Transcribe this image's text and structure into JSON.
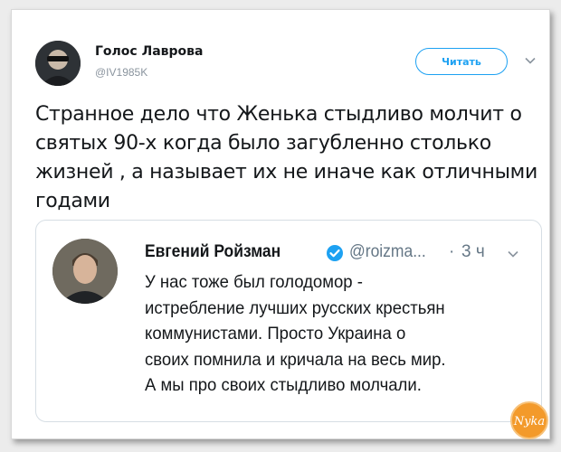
{
  "tweet": {
    "author_name": "Голос Лаврова",
    "author_handle": "@IV1985K",
    "follow_label": "Читать",
    "text": "Странное дело что Женька стыдливо молчит о святых 90-х когда было загубленно столько жизней , а называет их не иначе как отличными годами"
  },
  "quoted": {
    "author_name": "Евгений Ройзман",
    "handle": "@roizma...",
    "separator": "·",
    "time": "3 ч",
    "lines": [
      "У нас тоже был голодомор -",
      "истребление лучших русских крестьян",
      "коммунистами. Просто Украина о",
      "своих помнила и кричала на весь мир.",
      "А мы про своих стыдливо молчали."
    ]
  },
  "watermark": {
    "text": "Nyka"
  },
  "colors": {
    "accent": "#1da1f2",
    "muted": "#657786",
    "text": "#14171a",
    "logo": "#f39a2b"
  },
  "icons": {
    "avatar": "avatar-icon",
    "verified": "verified-badge-icon",
    "caret": "chevron-down-icon",
    "logo": "watermark-logo-icon"
  }
}
